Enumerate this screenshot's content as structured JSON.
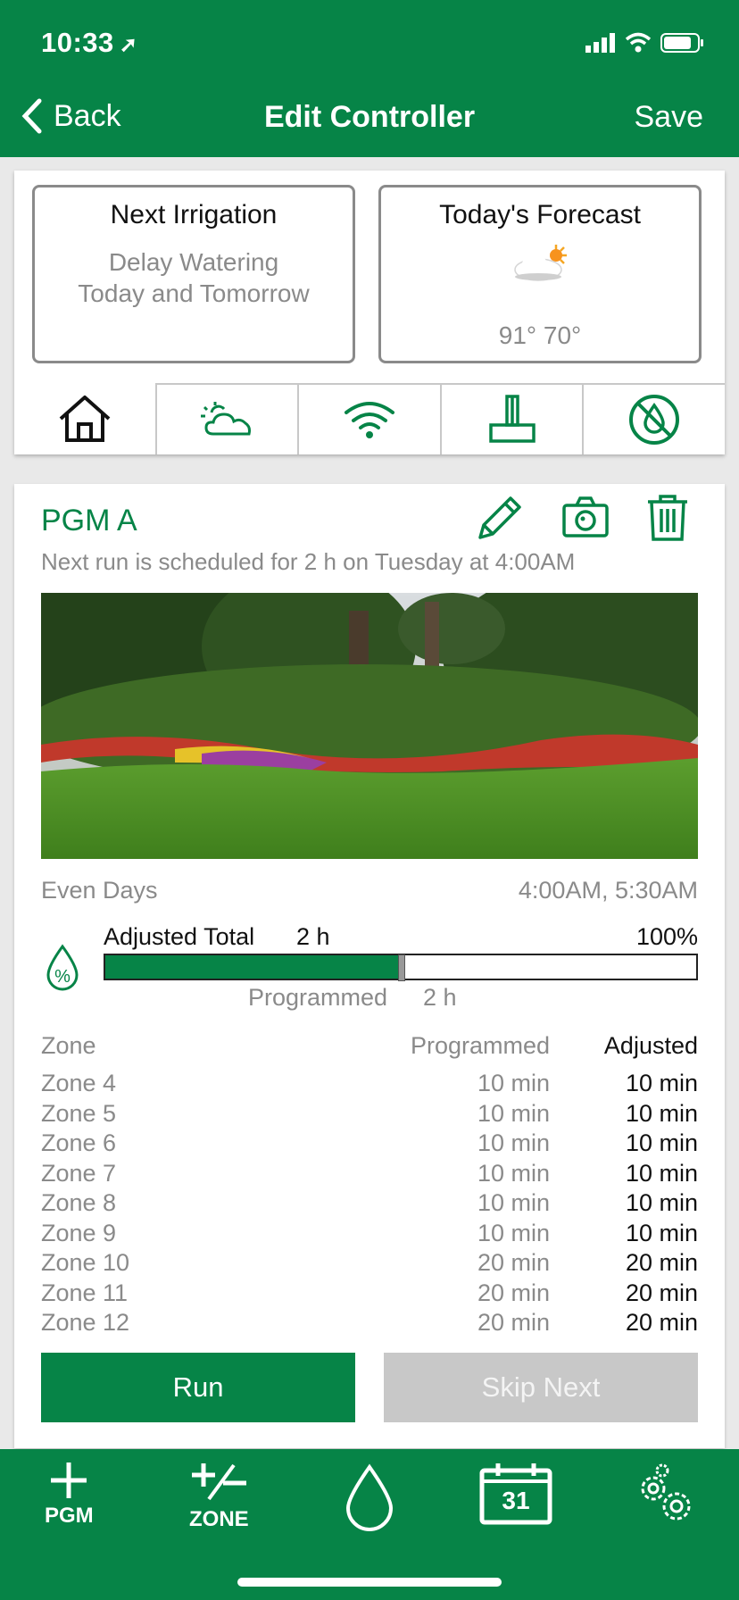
{
  "status": {
    "time": "10:33"
  },
  "nav": {
    "back": "Back",
    "title": "Edit Controller",
    "save": "Save"
  },
  "summary": {
    "next_irrigation_title": "Next Irrigation",
    "next_irrigation_line1": "Delay Watering",
    "next_irrigation_line2": "Today and Tomorrow",
    "forecast_title": "Today's Forecast",
    "forecast_icon": "partly-sunny-icon",
    "forecast_temps": "91° 70°"
  },
  "tabs": [
    {
      "icon": "home-icon",
      "active": true
    },
    {
      "icon": "weather-icon"
    },
    {
      "icon": "wifi-icon"
    },
    {
      "icon": "sensor-icon"
    },
    {
      "icon": "no-water-icon"
    }
  ],
  "program": {
    "name": "PGM A",
    "next_run": "Next run is scheduled for 2 h on Tuesday at 4:00AM",
    "days": "Even Days",
    "start_times": "4:00AM, 5:30AM",
    "adjusted_label": "Adjusted Total",
    "adjusted_value": "2 h",
    "adjusted_percent": "100%",
    "bar_fraction": 0.5,
    "programmed_label": "Programmed",
    "programmed_value": "2 h"
  },
  "zone_table": {
    "headers": {
      "zone": "Zone",
      "programmed": "Programmed",
      "adjusted": "Adjusted"
    },
    "rows": [
      {
        "zone": "Zone 4",
        "programmed": "10 min",
        "adjusted": "10 min"
      },
      {
        "zone": "Zone 5",
        "programmed": "10 min",
        "adjusted": "10 min"
      },
      {
        "zone": "Zone 6",
        "programmed": "10 min",
        "adjusted": "10 min"
      },
      {
        "zone": "Zone 7",
        "programmed": "10 min",
        "adjusted": "10 min"
      },
      {
        "zone": "Zone 8",
        "programmed": "10 min",
        "adjusted": "10 min"
      },
      {
        "zone": "Zone 9",
        "programmed": "10 min",
        "adjusted": "10 min"
      },
      {
        "zone": "Zone 10",
        "programmed": "20 min",
        "adjusted": "20 min"
      },
      {
        "zone": "Zone 11",
        "programmed": "20 min",
        "adjusted": "20 min"
      },
      {
        "zone": "Zone 12",
        "programmed": "20 min",
        "adjusted": "20 min"
      }
    ]
  },
  "buttons": {
    "run": "Run",
    "skip_next": "Skip Next"
  },
  "bottom_bar": {
    "add_pgm": "PGM",
    "add_zone": "ZONE",
    "calendar_day": "31"
  },
  "colors": {
    "brand": "#068447",
    "disabled": "#c8c8c8",
    "muted_text": "#8a8a8a"
  }
}
